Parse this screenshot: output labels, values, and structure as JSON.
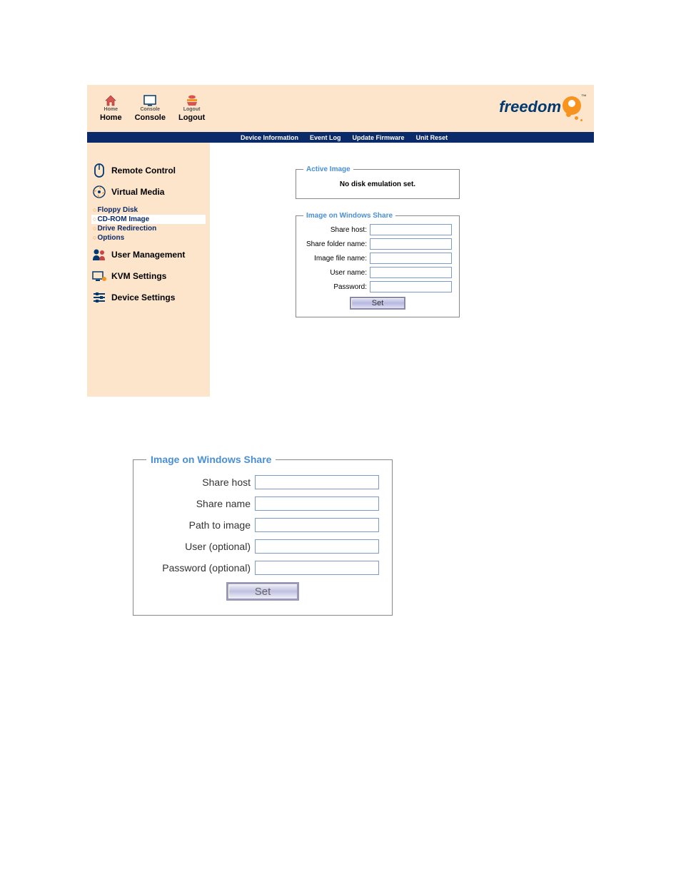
{
  "header": {
    "buttons": [
      {
        "tiny": "Home",
        "label": "Home"
      },
      {
        "tiny": "Console",
        "label": "Console"
      },
      {
        "tiny": "Logout",
        "label": "Logout"
      }
    ],
    "logo_text": "freedom"
  },
  "navbar": {
    "items": [
      "Device Information",
      "Event Log",
      "Update Firmware",
      "Unit Reset"
    ]
  },
  "sidebar": {
    "remote_control": "Remote Control",
    "virtual_media": "Virtual Media",
    "vm_subs": [
      "Floppy Disk",
      "CD-ROM Image",
      "Drive Redirection",
      "Options"
    ],
    "user_management": "User Management",
    "kvm_settings": "KVM Settings",
    "device_settings": "Device Settings"
  },
  "active_image": {
    "legend": "Active Image",
    "message": "No disk emulation set."
  },
  "win_share_small": {
    "legend": "Image on Windows Share",
    "fields": [
      "Share host:",
      "Share folder name:",
      "Image file name:",
      "User name:",
      "Password:"
    ],
    "button": "Set"
  },
  "win_share_big": {
    "legend": "Image on Windows Share",
    "fields": [
      "Share host",
      "Share name",
      "Path to image",
      "User (optional)",
      "Password (optional)"
    ],
    "button": "Set"
  }
}
